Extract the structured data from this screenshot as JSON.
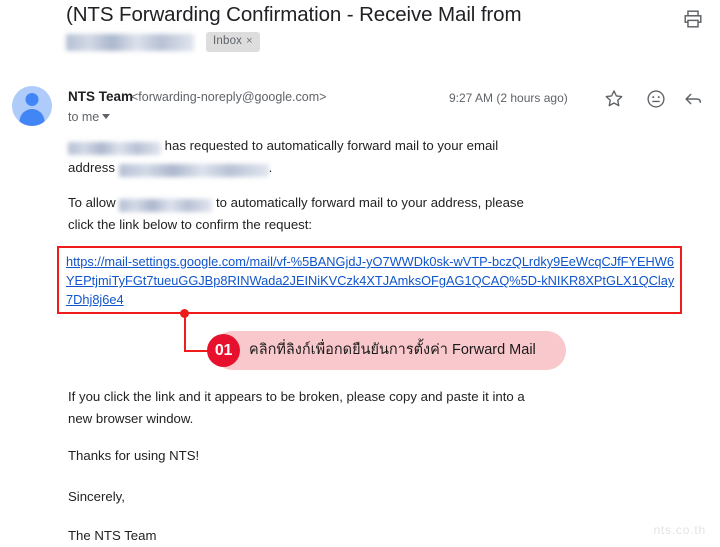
{
  "window": {
    "watermark": "nts.co.th"
  },
  "header": {
    "subject_line1": "(NTS Forwarding Confirmation - Receive Mail from",
    "subject_line2_redacted": "",
    "label_chip": "Inbox",
    "label_chip_close": "×",
    "print_icon": "printer-icon"
  },
  "message": {
    "sender_name": "NTS Team",
    "sender_email": "<forwarding-noreply@google.com>",
    "recipient": "to me",
    "timestamp": "9:27 AM (2 hours ago)",
    "actions": {
      "star": "star-icon",
      "emoji": "emoji-icon",
      "reply": "reply-icon"
    }
  },
  "body": {
    "para1_a": "",
    "para1_b": " has requested to automatically forward mail to your email address ",
    "para1_c": ".",
    "para2_a": "To allow ",
    "para2_b": " to automatically forward mail to your address, please click the link below to confirm the request:",
    "link_url": "https://mail-settings.google.com/mail/vf-%5BANGjdJ-yO7WWDk0sk-wVTP-bczQLrdky9EeWcqCJfFYEHW6YEPtjmiTyFGt7tueuGGJBp8RINWada2JEINiKVCzk4XTJAmksOFgAG1QCAQ%5D-kNIKR8XPtGLX1QClay7Dhj8j6e4",
    "para3": "If you click the link and it appears to be broken, please copy and paste it into a new browser window.",
    "para4": "Thanks for using NTS!",
    "para5": "Sincerely,",
    "para6": "The NTS Team"
  },
  "annotation": {
    "step_number": "01",
    "text": "คลิกที่ลิงก์เพื่อกดยืนยันการตั้งค่า Forward Mail",
    "accent_color": "#e8112d",
    "pill_color": "#f9c8cc",
    "box_color": "#ef1c1c"
  }
}
